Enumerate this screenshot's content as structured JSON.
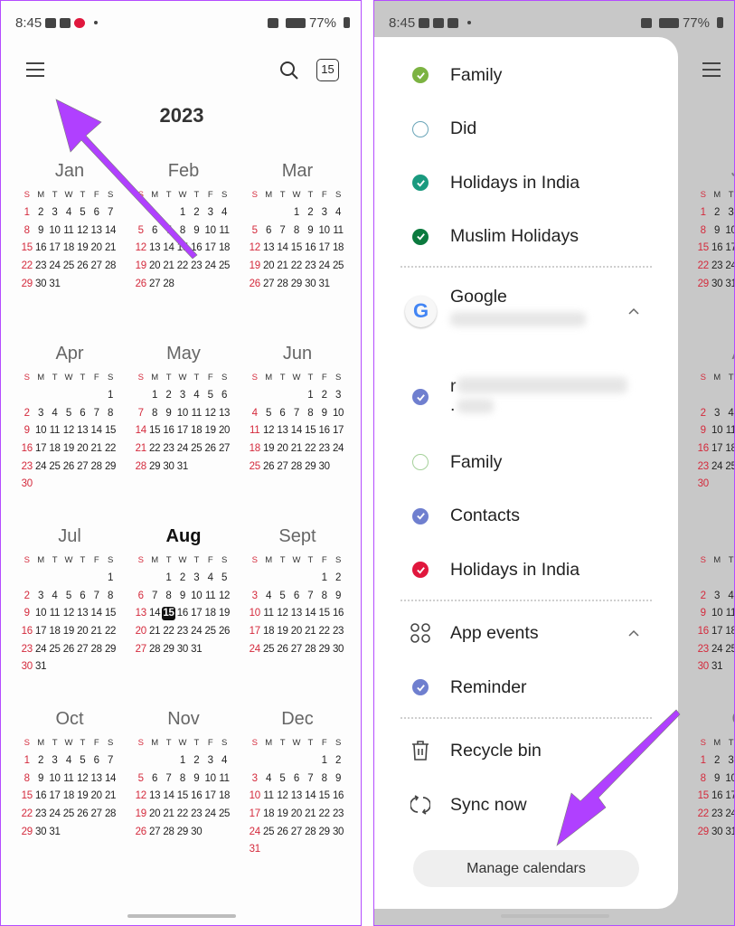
{
  "left": {
    "status": {
      "time": "8:45",
      "battery": "77%"
    },
    "header": {
      "today_day": "15"
    },
    "year": 2023,
    "weekday_letters": [
      "S",
      "M",
      "T",
      "W",
      "T",
      "F",
      "S"
    ],
    "months": [
      "Jan",
      "Feb",
      "Mar",
      "Apr",
      "May",
      "Jun",
      "Jul",
      "Aug",
      "Sept",
      "Oct",
      "Nov",
      "Dec"
    ],
    "current_month": "Aug",
    "today": {
      "month": "Aug",
      "day": 15
    }
  },
  "right": {
    "status": {
      "time": "8:45",
      "battery": "77%"
    },
    "drawer": {
      "local_calendars": [
        {
          "label": "Family",
          "checked": true,
          "color": "#7cb342"
        },
        {
          "label": "Did",
          "checked": false,
          "color": "#6aa5b8"
        },
        {
          "label": "Holidays in India",
          "checked": true,
          "color": "#1a9a7f"
        },
        {
          "label": "Muslim Holidays",
          "checked": true,
          "color": "#0b7a3e"
        }
      ],
      "google": {
        "title": "Google",
        "account_prefix": "r",
        "account_suffix": ".",
        "calendars": [
          {
            "label": "Family",
            "checked": false,
            "color": "#a5d19a"
          },
          {
            "label": "Contacts",
            "checked": true,
            "color": "#6f7fcf"
          },
          {
            "label": "Holidays in India",
            "checked": true,
            "color": "#e0173d"
          }
        ]
      },
      "app_events": {
        "title": "App events",
        "calendars": [
          {
            "label": "Reminder",
            "checked": true,
            "color": "#6f7fcf"
          }
        ]
      },
      "recycle_bin": "Recycle bin",
      "sync_now": "Sync now",
      "manage_calendars": "Manage calendars"
    }
  },
  "annotation_color": "#b040ff"
}
